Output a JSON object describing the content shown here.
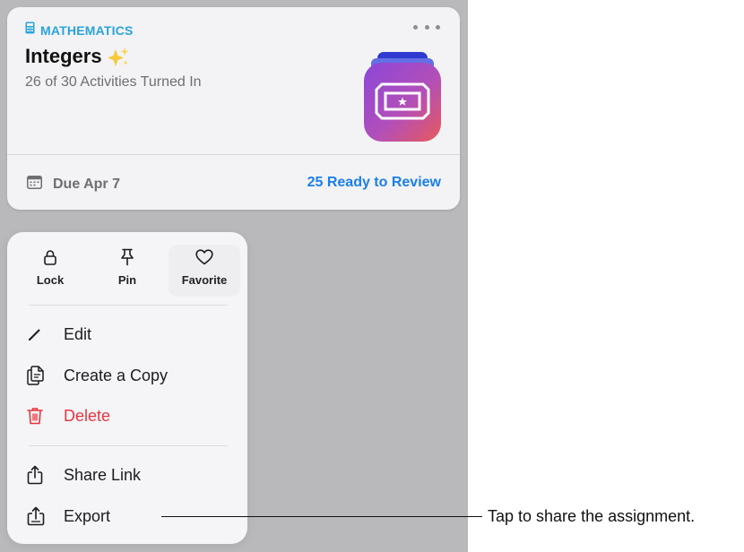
{
  "card": {
    "subject": "MATHEMATICS",
    "title": "Integers",
    "activities": "26 of 30 Activities Turned In",
    "due": "Due Apr 7",
    "review": "25 Ready to Review"
  },
  "menu": {
    "quick_actions": [
      {
        "label": "Lock",
        "icon": "lock-icon"
      },
      {
        "label": "Pin",
        "icon": "pin-icon"
      },
      {
        "label": "Favorite",
        "icon": "heart-icon"
      }
    ],
    "items": [
      {
        "label": "Edit",
        "icon": "pencil-icon"
      },
      {
        "label": "Create a Copy",
        "icon": "copy-icon"
      },
      {
        "label": "Delete",
        "icon": "trash-icon"
      },
      {
        "label": "Share Link",
        "icon": "share-icon"
      },
      {
        "label": "Export",
        "icon": "export-icon"
      }
    ]
  },
  "callout": {
    "text": "Tap to share the assignment."
  },
  "colors": {
    "subject": "#2aa3dc",
    "link": "#1a7fe8",
    "danger": "#e8343f",
    "background": "#b9b9bb"
  }
}
